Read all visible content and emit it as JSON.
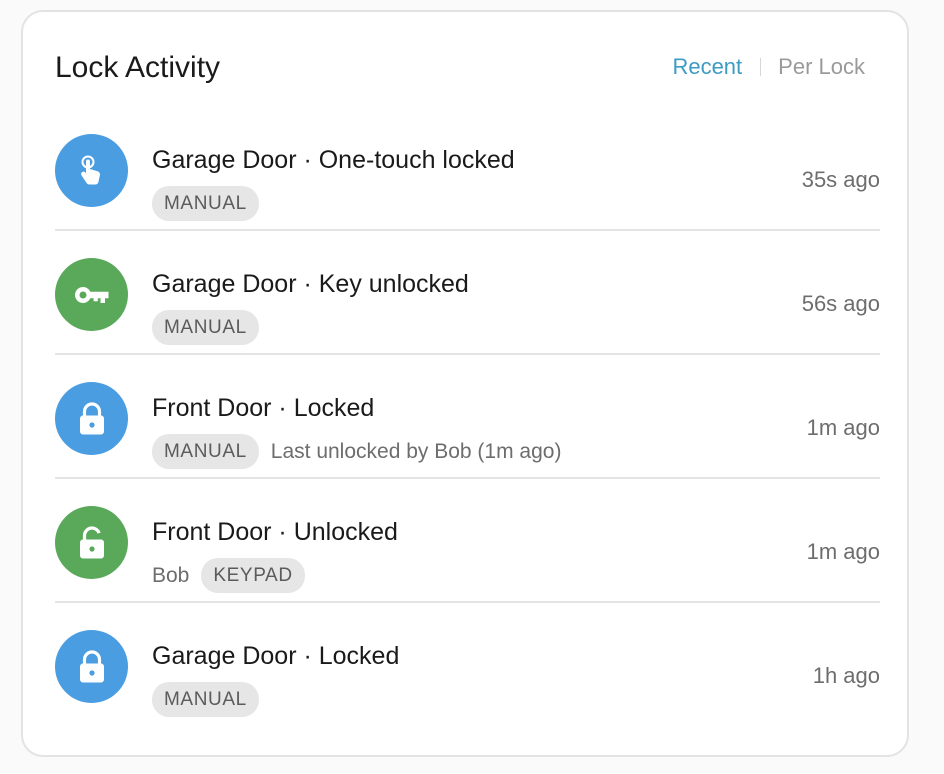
{
  "card": {
    "title": "Lock Activity",
    "tabs": [
      {
        "label": "Recent",
        "active": true
      },
      {
        "label": "Per Lock",
        "active": false
      }
    ]
  },
  "colors": {
    "blue": "#4a9de0",
    "green": "#5aa95a",
    "accent": "#3d9bc4"
  },
  "events": [
    {
      "title": "Garage Door · One-touch locked",
      "icon": "touch-icon",
      "color": "blue",
      "badge": "MANUAL",
      "time": "35s ago"
    },
    {
      "title": "Garage Door · Key unlocked",
      "icon": "key-icon",
      "color": "green",
      "badge": "MANUAL",
      "time": "56s ago"
    },
    {
      "title": "Front Door · Locked",
      "icon": "lock-icon",
      "color": "blue",
      "badge": "MANUAL",
      "note": "Last unlocked by Bob (1m ago)",
      "time": "1m ago"
    },
    {
      "title": "Front Door · Unlocked",
      "icon": "unlock-icon",
      "color": "green",
      "user": "Bob",
      "badge": "KEYPAD",
      "time": "1m ago"
    },
    {
      "title": "Garage Door · Locked",
      "icon": "lock-icon",
      "color": "blue",
      "badge": "MANUAL",
      "time": "1h ago"
    }
  ]
}
